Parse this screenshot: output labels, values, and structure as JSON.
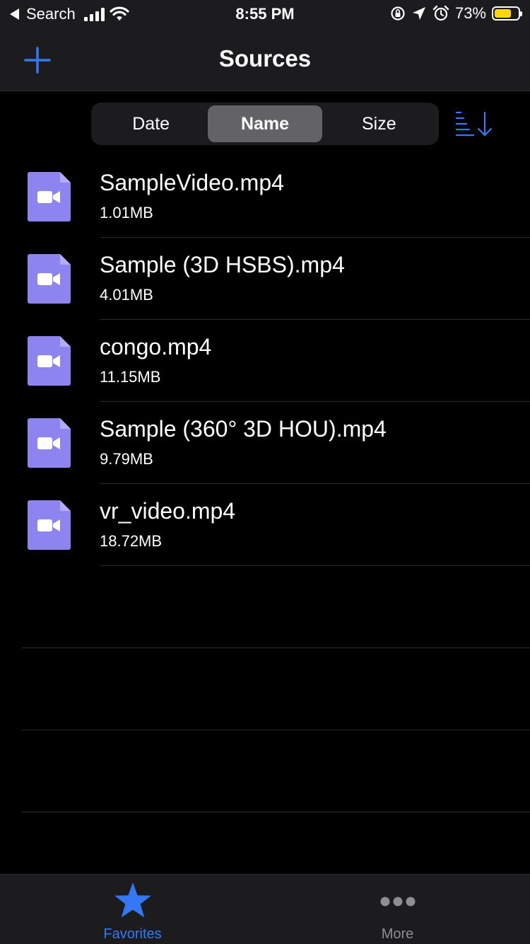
{
  "status_bar": {
    "back_label": "Search",
    "time": "8:55 PM",
    "battery_percent": "73%",
    "battery_level": 0.73
  },
  "nav": {
    "title": "Sources",
    "add_icon": "plus-icon"
  },
  "sort_control": {
    "segments": [
      "Date",
      "Name",
      "Size"
    ],
    "selected": "Name",
    "order_icon": "sort-descending-icon"
  },
  "files": [
    {
      "name": "SampleVideo.mp4",
      "size": "1.01MB",
      "icon": "video-file-icon"
    },
    {
      "name": "Sample (3D HSBS).mp4",
      "size": "4.01MB",
      "icon": "video-file-icon"
    },
    {
      "name": "congo.mp4",
      "size": "11.15MB",
      "icon": "video-file-icon"
    },
    {
      "name": "Sample (360° 3D HOU).mp4",
      "size": "9.79MB",
      "icon": "video-file-icon"
    },
    {
      "name": "vr_video.mp4",
      "size": "18.72MB",
      "icon": "video-file-icon"
    }
  ],
  "tab_bar": {
    "tabs": [
      {
        "label": "Favorites",
        "icon": "star-icon",
        "active": true
      },
      {
        "label": "More",
        "icon": "more-dots-icon",
        "active": false
      }
    ]
  },
  "colors": {
    "accent": "#3478f6",
    "file_icon": "#8e84f0",
    "background": "#000000",
    "bar_background": "#1c1c1e",
    "battery": "#ffd60a"
  }
}
